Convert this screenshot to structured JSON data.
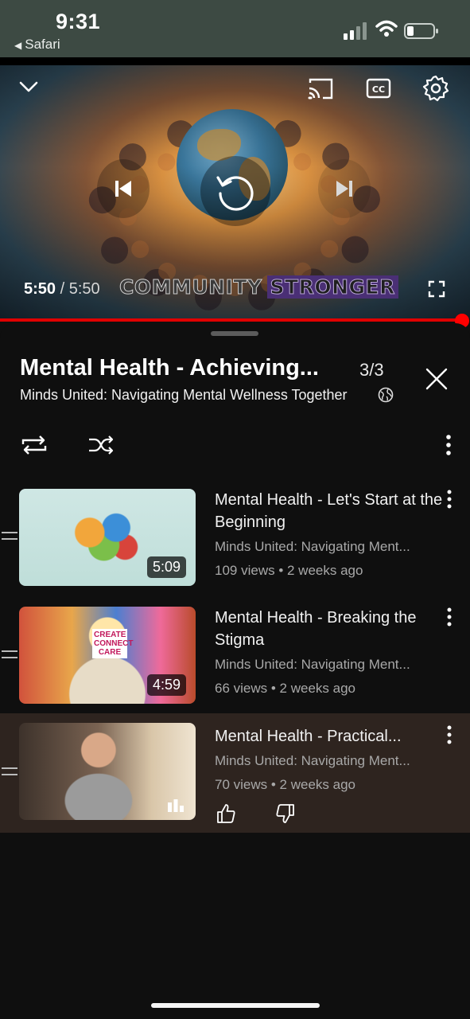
{
  "status_bar": {
    "time": "9:31",
    "back_app": "Safari"
  },
  "player": {
    "current_time": "5:50",
    "separator": " / ",
    "duration": "5:50",
    "overlay_text_a": "COMMUNITY",
    "overlay_text_b": "STRONGER",
    "progress_fraction": 0.99,
    "accent_color": "#ff0000"
  },
  "playlist": {
    "title": "Mental Health - Achieving...",
    "count": "3/3",
    "channel": "Minds United: Navigating Mental Wellness Together"
  },
  "videos": [
    {
      "title": "Mental Health - Let's Start at the Beginning",
      "channel": "Minds United: Navigating Ment...",
      "meta": "109 views • 2 weeks ago",
      "duration": "5:09",
      "thumbnail_text": ""
    },
    {
      "title": "Mental Health - Breaking the Stigma",
      "channel": "Minds United: Navigating Ment...",
      "meta": "66 views • 2 weeks ago",
      "duration": "4:59",
      "thumbnail_text": "CREATE CONNECT CARE"
    },
    {
      "title": "Mental Health - Practical...",
      "channel": "Minds United: Navigating Ment...",
      "meta": "70 views • 2 weeks ago",
      "now_playing": true
    }
  ],
  "icons": {
    "status": [
      "signal-icon",
      "wifi-icon",
      "battery-icon"
    ],
    "player": [
      "chevron-down-icon",
      "cast-icon",
      "closed-captions-icon",
      "settings-gear-icon",
      "previous-icon",
      "replay-icon",
      "next-icon",
      "fullscreen-icon"
    ],
    "playlist": [
      "close-icon",
      "globe-icon",
      "loop-icon",
      "shuffle-icon",
      "more-vertical-icon",
      "thumbs-up-icon",
      "thumbs-down-icon",
      "now-playing-bars-icon",
      "drag-handle-icon"
    ]
  }
}
